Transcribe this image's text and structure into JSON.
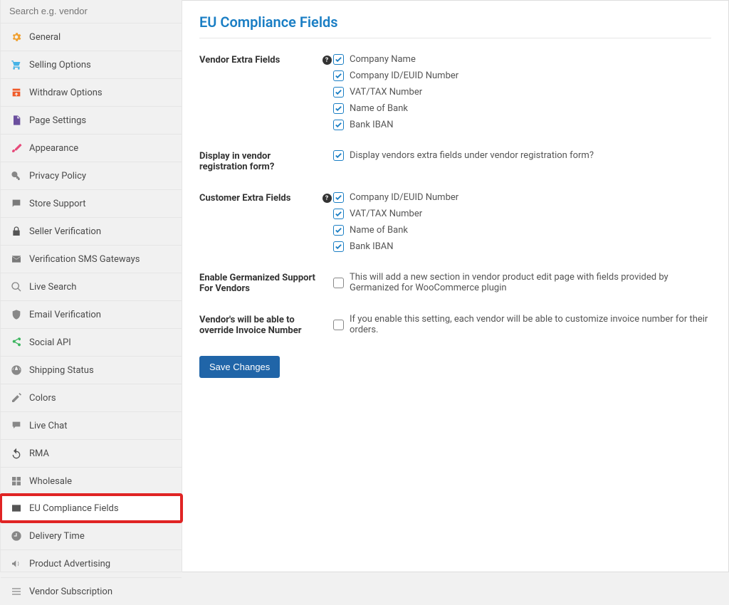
{
  "search": {
    "placeholder": "Search e.g. vendor"
  },
  "sidebar": {
    "items": [
      {
        "label": "General",
        "icon": "gear",
        "color": "#f0a030"
      },
      {
        "label": "Selling Options",
        "icon": "cart",
        "color": "#46b3e6"
      },
      {
        "label": "Withdraw Options",
        "icon": "withdraw",
        "color": "#f05a28"
      },
      {
        "label": "Page Settings",
        "icon": "page",
        "color": "#6b4f9e"
      },
      {
        "label": "Appearance",
        "icon": "brush",
        "color": "#e64b7a"
      },
      {
        "label": "Privacy Policy",
        "icon": "key",
        "color": "#888"
      },
      {
        "label": "Store Support",
        "icon": "chat",
        "color": "#7a7a7a"
      },
      {
        "label": "Seller Verification",
        "icon": "lock",
        "color": "#555"
      },
      {
        "label": "Verification SMS Gateways",
        "icon": "mail",
        "color": "#7a7a7a"
      },
      {
        "label": "Live Search",
        "icon": "search",
        "color": "#888"
      },
      {
        "label": "Email Verification",
        "icon": "shield",
        "color": "#888"
      },
      {
        "label": "Social API",
        "icon": "share",
        "color": "#3bb55e"
      },
      {
        "label": "Shipping Status",
        "icon": "globe",
        "color": "#888"
      },
      {
        "label": "Colors",
        "icon": "pencil",
        "color": "#888"
      },
      {
        "label": "Live Chat",
        "icon": "balloon",
        "color": "#888"
      },
      {
        "label": "RMA",
        "icon": "undo",
        "color": "#555"
      },
      {
        "label": "Wholesale",
        "icon": "boxes",
        "color": "#888"
      },
      {
        "label": "EU Compliance Fields",
        "icon": "card",
        "color": "#555",
        "active": true
      },
      {
        "label": "Delivery Time",
        "icon": "clock",
        "color": "#888"
      },
      {
        "label": "Product Advertising",
        "icon": "megaphone",
        "color": "#888"
      },
      {
        "label": "Vendor Subscription",
        "icon": "menu",
        "color": "#888"
      }
    ]
  },
  "page": {
    "title": "EU Compliance Fields"
  },
  "sections": {
    "vendor_extra": {
      "label": "Vendor Extra Fields",
      "help": true,
      "options": [
        {
          "label": "Company Name",
          "checked": true
        },
        {
          "label": "Company ID/EUID Number",
          "checked": true
        },
        {
          "label": "VAT/TAX Number",
          "checked": true
        },
        {
          "label": "Name of Bank",
          "checked": true
        },
        {
          "label": "Bank IBAN",
          "checked": true
        }
      ]
    },
    "display_reg": {
      "label": "Display in vendor registration form?",
      "options": [
        {
          "label": "Display vendors extra fields under vendor registration form?",
          "checked": true
        }
      ]
    },
    "customer_extra": {
      "label": "Customer Extra Fields",
      "help": true,
      "options": [
        {
          "label": "Company ID/EUID Number",
          "checked": true
        },
        {
          "label": "VAT/TAX Number",
          "checked": true
        },
        {
          "label": "Name of Bank",
          "checked": true
        },
        {
          "label": "Bank IBAN",
          "checked": true
        }
      ]
    },
    "germanized": {
      "label": "Enable Germanized Support For Vendors",
      "options": [
        {
          "label": "This will add a new section in vendor product edit page with fields provided by Germanized for WooCommerce plugin",
          "checked": false
        }
      ]
    },
    "invoice": {
      "label": "Vendor's will be able to override Invoice Number",
      "options": [
        {
          "label": "If you enable this setting, each vendor will be able to customize invoice number for their orders.",
          "checked": false
        }
      ]
    }
  },
  "save_button": "Save Changes"
}
